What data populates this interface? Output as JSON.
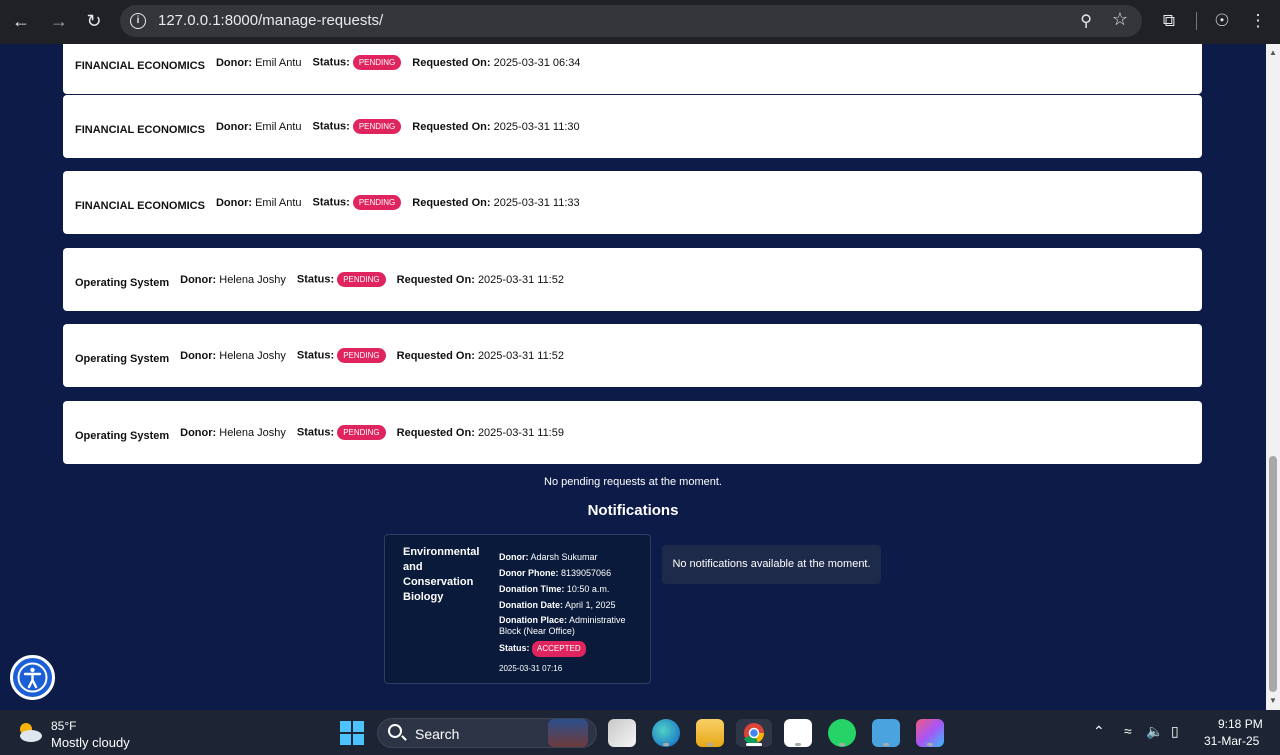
{
  "browser": {
    "url": "127.0.0.1:8000/manage-requests/"
  },
  "requests": [
    {
      "book": "FINANCIAL ECONOMICS",
      "donor_label": "Donor:",
      "donor": "Emil Antu",
      "status_label": "Status:",
      "status": "PENDING",
      "requested_label": "Requested On:",
      "requested": "2025-03-31 06:34"
    },
    {
      "book": "FINANCIAL ECONOMICS",
      "donor_label": "Donor:",
      "donor": "Emil Antu",
      "status_label": "Status:",
      "status": "PENDING",
      "requested_label": "Requested On:",
      "requested": "2025-03-31 11:30"
    },
    {
      "book": "FINANCIAL ECONOMICS",
      "donor_label": "Donor:",
      "donor": "Emil Antu",
      "status_label": "Status:",
      "status": "PENDING",
      "requested_label": "Requested On:",
      "requested": "2025-03-31 11:33"
    },
    {
      "book": "Operating System",
      "donor_label": "Donor:",
      "donor": "Helena Joshy",
      "status_label": "Status:",
      "status": "PENDING",
      "requested_label": "Requested On:",
      "requested": "2025-03-31 11:52"
    },
    {
      "book": "Operating System",
      "donor_label": "Donor:",
      "donor": "Helena Joshy",
      "status_label": "Status:",
      "status": "PENDING",
      "requested_label": "Requested On:",
      "requested": "2025-03-31 11:52"
    },
    {
      "book": "Operating System",
      "donor_label": "Donor:",
      "donor": "Helena Joshy",
      "status_label": "Status:",
      "status": "PENDING",
      "requested_label": "Requested On:",
      "requested": "2025-03-31 11:59"
    }
  ],
  "no_pending_text": "No pending requests at the moment.",
  "notifications": {
    "title": "Notifications",
    "card": {
      "book": "Environmental and Conservation Biology",
      "donor_label": "Donor:",
      "donor": "Adarsh Sukumar",
      "phone_label": "Donor Phone:",
      "phone": "8139057066",
      "time_label": "Donation Time:",
      "time": "10:50 a.m.",
      "date_label": "Donation Date:",
      "date": "April 1, 2025",
      "place_label": "Donation Place:",
      "place": "Administrative Block (Near Office)",
      "status_label": "Status:",
      "status": "ACCEPTED",
      "timestamp": "2025-03-31 07:16"
    },
    "empty_text": "No notifications available at the moment."
  },
  "taskbar": {
    "temperature": "85°F",
    "weather": "Mostly cloudy",
    "search_label": "Search",
    "time": "9:18 PM",
    "date": "31-Mar-25"
  },
  "colors": {
    "page_bg": "#0c1b47",
    "badge": "#e0245e",
    "accent_blue": "#1b5fd6"
  }
}
